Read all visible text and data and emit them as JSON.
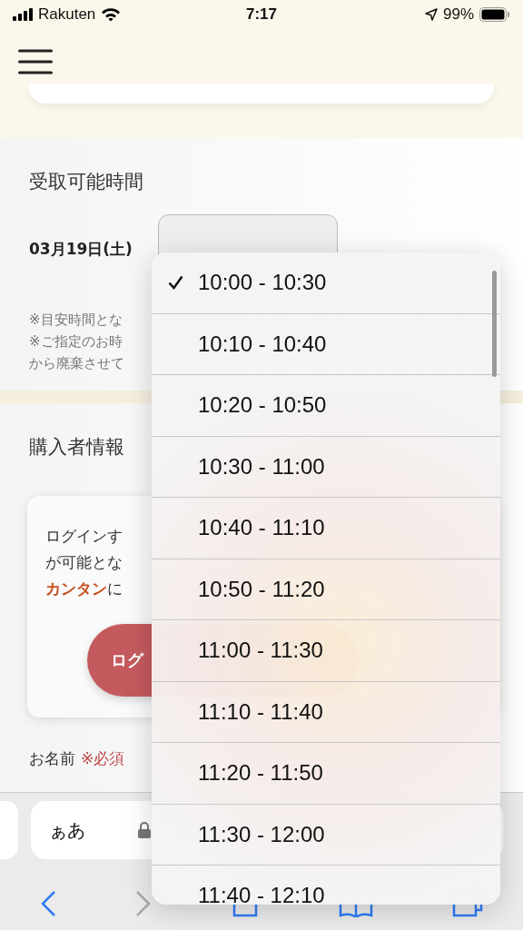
{
  "status_bar": {
    "carrier": "Rakuten",
    "time": "7:17",
    "battery": "99%"
  },
  "pickup": {
    "title": "受取可能時間",
    "date": "03月19日(土)",
    "notes": [
      "※目安時間とな",
      "※ご指定のお時",
      "から廃棄させて"
    ]
  },
  "buyer": {
    "title": "購入者情報",
    "login_text": [
      "ログインす",
      "が可能とな",
      "**カンタン**に"
    ],
    "login_button": "ログ",
    "name_label": "お名前",
    "required": "※必須"
  },
  "browser": {
    "address": "ぁあ"
  },
  "time_menu": {
    "options": [
      {
        "label": "10:00 - 10:30",
        "selected": true
      },
      {
        "label": "10:10 - 10:40",
        "selected": false
      },
      {
        "label": "10:20 - 10:50",
        "selected": false
      },
      {
        "label": "10:30 - 11:00",
        "selected": false
      },
      {
        "label": "10:40 - 11:10",
        "selected": false
      },
      {
        "label": "10:50 - 11:20",
        "selected": false
      },
      {
        "label": "11:00 - 11:30",
        "selected": false
      },
      {
        "label": "11:10 - 11:40",
        "selected": false
      },
      {
        "label": "11:20 - 11:50",
        "selected": false
      },
      {
        "label": "11:30 - 12:00",
        "selected": false
      },
      {
        "label": "11:40 - 12:10",
        "selected": false
      }
    ]
  }
}
